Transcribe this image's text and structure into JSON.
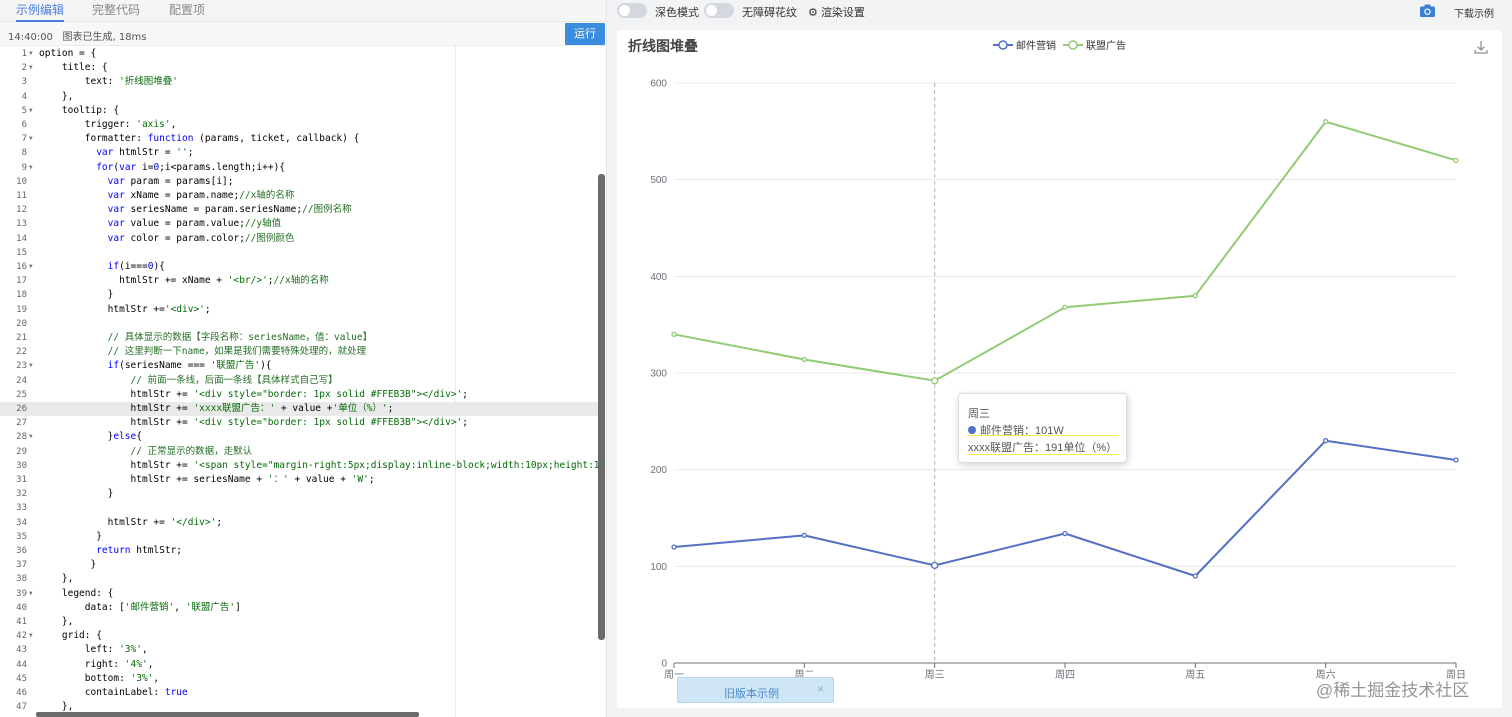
{
  "tabs": [
    "示例编辑",
    "完整代码",
    "配置项"
  ],
  "status": {
    "time": "14:40:00",
    "message": "图表已生成, 18ms"
  },
  "run_label": "运行",
  "toolbar": {
    "dark_mode_label": "深色模式",
    "decal_label": "无障碍花纹",
    "render_settings_label": "渲染设置",
    "download_label": "下载示例"
  },
  "code_lines": [
    {
      "n": 1,
      "fold": true,
      "t": "option = {"
    },
    {
      "n": 2,
      "fold": true,
      "t": "    title: {"
    },
    {
      "n": 3,
      "t": "        text: '折线图堆叠'"
    },
    {
      "n": 4,
      "t": "    },"
    },
    {
      "n": 5,
      "fold": true,
      "t": "    tooltip: {"
    },
    {
      "n": 6,
      "t": "        trigger: 'axis',"
    },
    {
      "n": 7,
      "fold": true,
      "t": "        formatter: function (params, ticket, callback) {"
    },
    {
      "n": 8,
      "t": "          var htmlStr = '';"
    },
    {
      "n": 9,
      "fold": true,
      "t": "          for(var i=0;i<params.length;i++){"
    },
    {
      "n": 10,
      "t": "            var param = params[i];"
    },
    {
      "n": 11,
      "t": "            var xName = param.name;//x轴的名称"
    },
    {
      "n": 12,
      "t": "            var seriesName = param.seriesName;//图例名称"
    },
    {
      "n": 13,
      "t": "            var value = param.value;//y轴值"
    },
    {
      "n": 14,
      "t": "            var color = param.color;//图例颜色"
    },
    {
      "n": 15,
      "t": ""
    },
    {
      "n": 16,
      "fold": true,
      "t": "            if(i===0){"
    },
    {
      "n": 17,
      "t": "              htmlStr += xName + '<br/>';//x轴的名称"
    },
    {
      "n": 18,
      "t": "            }"
    },
    {
      "n": 19,
      "t": "            htmlStr +='<div>';"
    },
    {
      "n": 20,
      "t": ""
    },
    {
      "n": 21,
      "t": "            // 具体显示的数据【字段名称：seriesName，值：value】"
    },
    {
      "n": 22,
      "t": "            // 这里判断一下name，如果是我们需要特殊处理的，就处理"
    },
    {
      "n": 23,
      "fold": true,
      "t": "            if(seriesName === '联盟广告'){"
    },
    {
      "n": 24,
      "t": "                // 前面一条线，后面一条线【具体样式自己写】"
    },
    {
      "n": 25,
      "t": "                htmlStr += '<div style=\"border: 1px solid #FFEB3B\"></div>';"
    },
    {
      "n": 26,
      "t": "                htmlStr += 'xxxx联盟广告：' + value +'单位（%）';",
      "hl": true
    },
    {
      "n": 27,
      "t": "                htmlStr += '<div style=\"border: 1px solid #FFEB3B\"></div>';"
    },
    {
      "n": 28,
      "fold": true,
      "t": "            }else{"
    },
    {
      "n": 29,
      "t": "                // 正常显示的数据，走默认"
    },
    {
      "n": 30,
      "t": "                htmlStr += '<span style=\"margin-right:5px;display:inline-block;width:10px;height:10px;border"
    },
    {
      "n": 31,
      "t": "                htmlStr += seriesName + '：' + value + 'W';"
    },
    {
      "n": 32,
      "t": "            }"
    },
    {
      "n": 33,
      "t": ""
    },
    {
      "n": 34,
      "t": "            htmlStr += '</div>';"
    },
    {
      "n": 35,
      "t": "          }"
    },
    {
      "n": 36,
      "t": "          return htmlStr;"
    },
    {
      "n": 37,
      "t": "         }"
    },
    {
      "n": 38,
      "t": "    },"
    },
    {
      "n": 39,
      "fold": true,
      "t": "    legend: {"
    },
    {
      "n": 40,
      "t": "        data: ['邮件营销', '联盟广告']"
    },
    {
      "n": 41,
      "t": "    },"
    },
    {
      "n": 42,
      "fold": true,
      "t": "    grid: {"
    },
    {
      "n": 43,
      "t": "        left: '3%',"
    },
    {
      "n": 44,
      "t": "        right: '4%',"
    },
    {
      "n": 45,
      "t": "        bottom: '3%',"
    },
    {
      "n": 46,
      "t": "        containLabel: true"
    },
    {
      "n": 47,
      "t": "    },"
    }
  ],
  "chart_data": {
    "type": "line",
    "title": "折线图堆叠",
    "categories": [
      "周一",
      "周二",
      "周三",
      "周四",
      "周五",
      "周六",
      "周日"
    ],
    "series": [
      {
        "name": "邮件营销",
        "color": "#5470c6",
        "values": [
          120,
          132,
          101,
          134,
          90,
          230,
          210
        ]
      },
      {
        "name": "联盟广告",
        "color": "#91cc75",
        "values": [
          340,
          314,
          292,
          368,
          380,
          560,
          520
        ]
      }
    ],
    "ylim": [
      0,
      600
    ],
    "yticks": [
      0,
      100,
      200,
      300,
      400,
      500,
      600
    ],
    "legend_position": "top-center",
    "grid": true,
    "highlight_category": "周三"
  },
  "tooltip": {
    "title": "周三",
    "line1": "邮件营销：101W",
    "line2": "xxxx联盟广告：191单位（%）"
  },
  "old_version": {
    "label": "旧版本示例",
    "close": "×"
  },
  "watermark": "@稀土掘金技术社区"
}
